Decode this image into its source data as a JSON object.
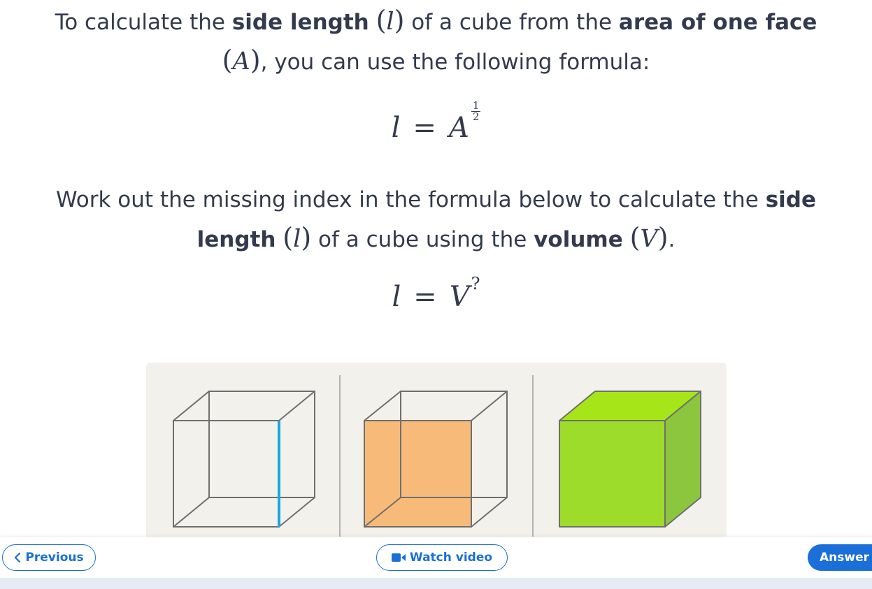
{
  "intro": {
    "text1": "To calculate the ",
    "bold1": "side length",
    "var_l": "l",
    "text2": " of a cube from the ",
    "bold2": "area of one face",
    "var_A": "A",
    "text3": ", you can use the following formula:"
  },
  "formula1": {
    "lhs": "l",
    "eq": "=",
    "base": "A",
    "exp_num": "1",
    "exp_den": "2"
  },
  "question": {
    "text1": "Work out the missing index in the formula below to calculate the ",
    "bold1": "side length",
    "var_l": "l",
    "text2": " of a cube using the ",
    "bold2": "volume",
    "var_V": "V",
    "text3": "."
  },
  "formula2": {
    "lhs": "l",
    "eq": "=",
    "base": "V",
    "exponent": "?"
  },
  "nav": {
    "previous_label": "Previous",
    "watch_video_label": "Watch video",
    "answer_label": "Answer"
  },
  "colors": {
    "accent": "#1a6fd8",
    "edge_highlight": "#1aa7e0",
    "face_fill": "#f7b064",
    "cube_front": "#9ddc2a",
    "cube_top": "#a6e619",
    "cube_side": "#8bc63e",
    "panel_bg": "#f3f1ec"
  }
}
